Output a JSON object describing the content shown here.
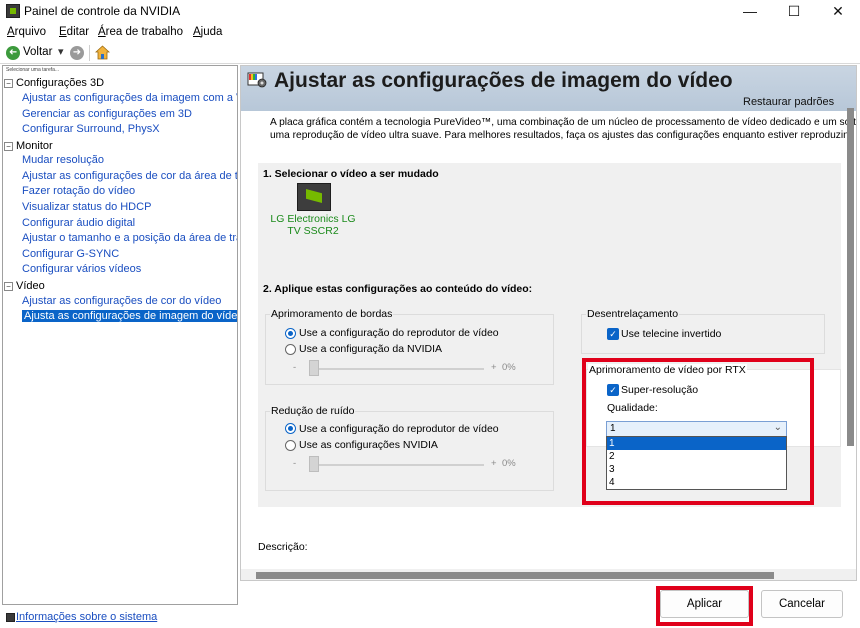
{
  "window": {
    "title": "Painel de controle da NVIDIA",
    "controls": {
      "minimize": "—",
      "maximize": "☐",
      "close": "✕"
    }
  },
  "menu": [
    {
      "label": "Arquivo",
      "accel": "A",
      "rest": "rquivo"
    },
    {
      "label": "Editar",
      "accel": "E",
      "rest": "ditar"
    },
    {
      "label": "Área de trabalho",
      "accel": "Á",
      "rest": "rea de trabalho"
    },
    {
      "label": "Ajuda",
      "accel": "A",
      "rest": "juda"
    }
  ],
  "toolbar": {
    "back_label": "Voltar",
    "dropdown_glyph": "▾",
    "forward_glyph": "➜",
    "back_glyph": "➜"
  },
  "sidebar": {
    "caption": "Selecionar uma tarefa...",
    "categories": [
      {
        "label": "Configurações 3D",
        "toggle": "−",
        "tasks": [
          "Ajustar as configurações da imagem com a Visual",
          "Gerenciar as configurações em 3D",
          "Configurar Surround, PhysX"
        ]
      },
      {
        "label": "Monitor",
        "toggle": "−",
        "tasks": [
          "Mudar resolução",
          "Ajustar as configurações de cor da área de trabal",
          "Fazer rotação do vídeo",
          "Visualizar status do HDCP",
          "Configurar áudio digital",
          "Ajustar o tamanho e a posição da área de trabalh",
          "Configurar G-SYNC",
          "Configurar vários vídeos"
        ]
      },
      {
        "label": "Vídeo",
        "toggle": "−",
        "tasks": [
          "Ajustar as configurações de cor do vídeo",
          "Ajusta as configurações de imagem do vídeo"
        ]
      }
    ],
    "selected_task": "Ajusta as configurações de imagem do vídeo"
  },
  "statusbar": {
    "system_info_link": "Informações sobre o sistema"
  },
  "main": {
    "title": "Ajustar as configurações de imagem do vídeo",
    "restore_defaults": "Restaurar padrões",
    "intro_line1": "A placa gráfica contém a tecnologia PureVideo™, uma combinação de um núcleo de processamento de vídeo dedicado e um softw",
    "intro_line2": "uma reprodução de vídeo ultra suave. Para melhores resultados, faça os ajustes das configurações enquanto estiver reproduzind",
    "section1": "1. Selecionar o vídeo a ser mudado",
    "display_name_line1": "LG Electronics LG",
    "display_name_line2": "TV SSCR2",
    "section2": "2. Aplique estas configurações ao conteúdo do vídeo:",
    "edge": {
      "label": "Aprimoramento de bordas",
      "opt1": "Use a configuração do reprodutor de vídeo",
      "opt2": "Use a configuração da NVIDIA",
      "selected": 1,
      "slider_min": "-",
      "slider_plus": "+",
      "slider_value": "0%"
    },
    "noise": {
      "label": "Redução de ruído",
      "opt1": "Use a configuração do reprodutor de vídeo",
      "opt2": "Use as configurações NVIDIA",
      "selected": 1,
      "slider_min": "-",
      "slider_plus": "+",
      "slider_value": "0%"
    },
    "deinterlace": {
      "label": "Desentrelaçamento",
      "checkbox": "Use telecine invertido",
      "checked": true
    },
    "rtx": {
      "label": "Aprimoramento de vídeo por RTX",
      "checkbox": "Super-resolução",
      "checked": true,
      "quality_label": "Qualidade:",
      "quality_value": "1",
      "quality_options": [
        "1",
        "2",
        "3",
        "4"
      ],
      "quality_selected_index": 0,
      "dropdown_glyph": "⌄"
    },
    "description_label": "Descrição:"
  },
  "buttons": {
    "apply": "Aplicar",
    "cancel": "Cancelar"
  },
  "colors": {
    "accent": "#0a64c8",
    "highlight": "#e0001a",
    "nvidia_green": "#76b900",
    "link": "#1a4ec0"
  }
}
